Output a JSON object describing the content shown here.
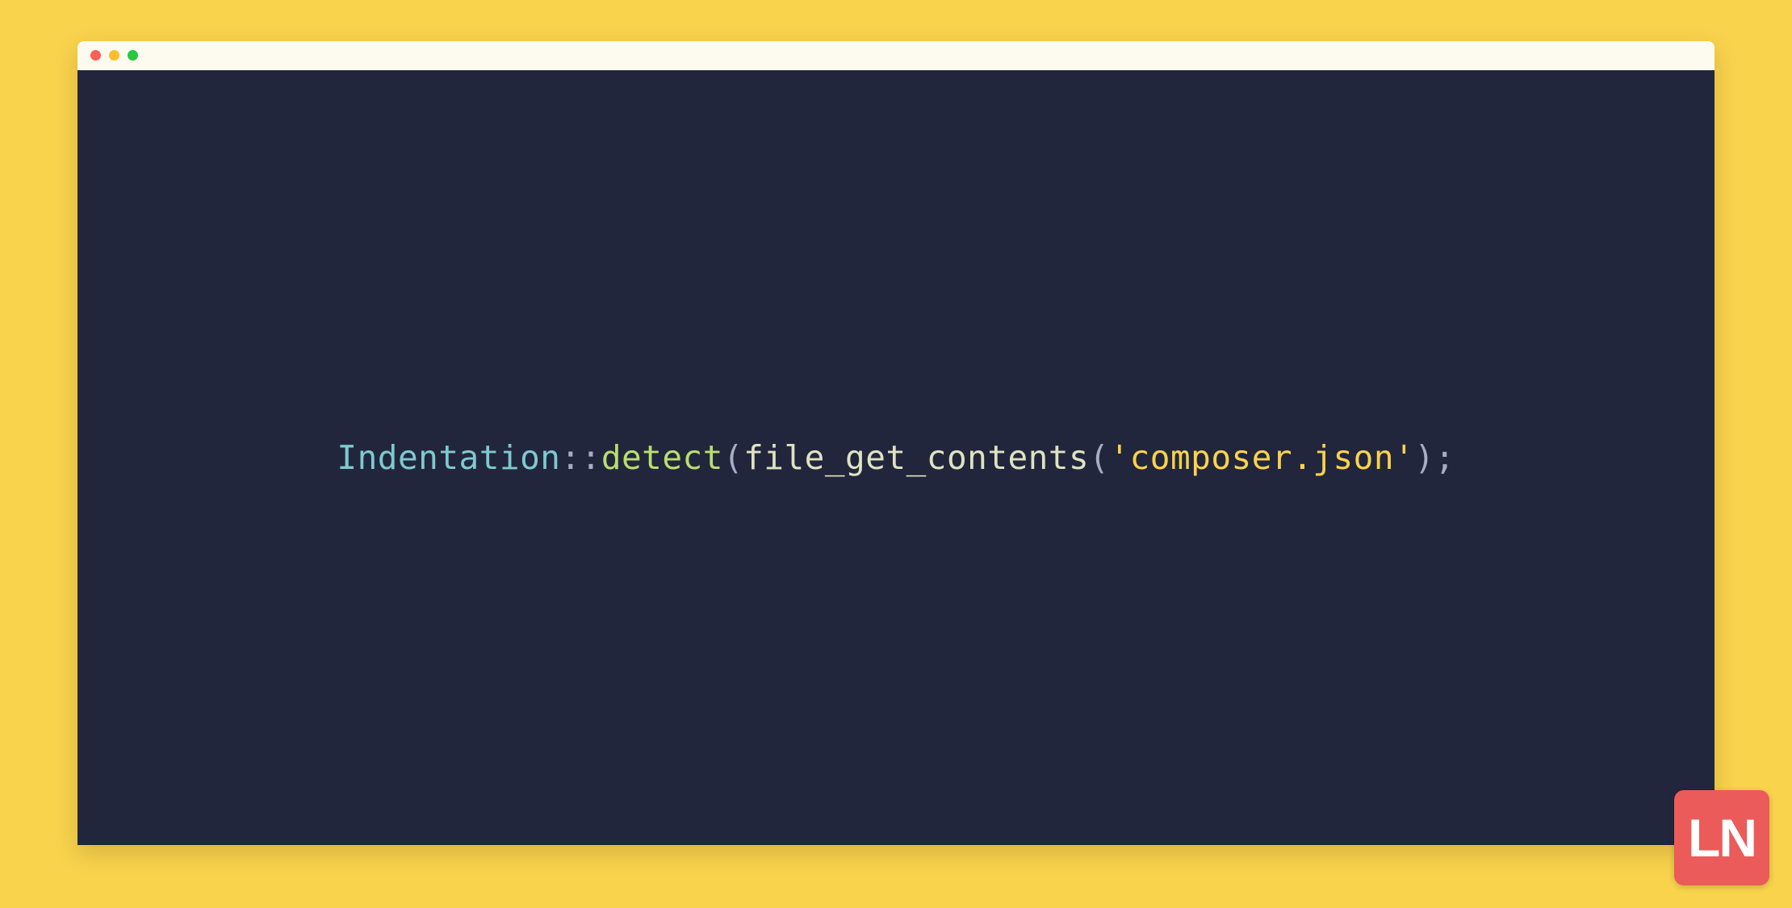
{
  "colors": {
    "page_bg": "#f9d34c",
    "editor_bg": "#22263c",
    "titlebar_bg": "#fdfaf0",
    "dot_close": "#ff5f56",
    "dot_min": "#ffbd2e",
    "dot_max": "#27c93f",
    "logo_bg": "#eb5b59"
  },
  "code": {
    "tokens": [
      {
        "text": "Indentation",
        "kind": "class"
      },
      {
        "text": "::",
        "kind": "op"
      },
      {
        "text": "detect",
        "kind": "method"
      },
      {
        "text": "(",
        "kind": "op"
      },
      {
        "text": "file_get_contents",
        "kind": "func"
      },
      {
        "text": "(",
        "kind": "op"
      },
      {
        "text": "'composer.json'",
        "kind": "string"
      },
      {
        "text": ");",
        "kind": "op"
      }
    ]
  },
  "logo": {
    "text": "LN"
  }
}
